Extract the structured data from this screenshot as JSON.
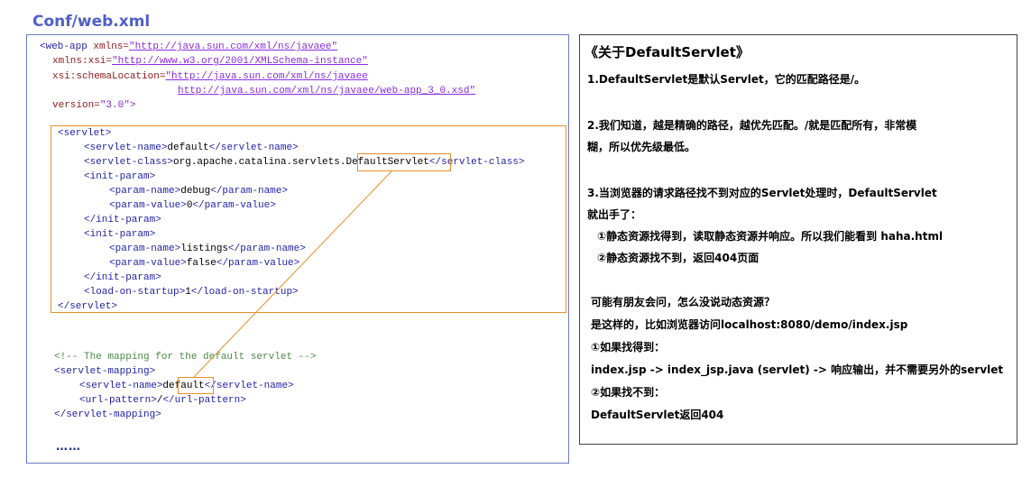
{
  "title": "Conf/web.xml",
  "code": {
    "webapp_open": "<web-app",
    "xmlns_attr": "xmlns=",
    "xmlns_val": "\"http://java.sun.com/xml/ns/javaee\"",
    "xsi_attr": "xmlns:xsi=",
    "xsi_val": "\"http://www.w3.org/2001/XMLSchema-instance\"",
    "schema_attr": "xsi:schemaLocation=",
    "schema_val1": "\"http://java.sun.com/xml/ns/javaee",
    "schema_val2": "http://java.sun.com/xml/ns/javaee/web-app_3_0.xsd\"",
    "version_attr": "version=",
    "version_val": "\"3.0\">",
    "servlet_open": "<servlet>",
    "sname_open": "<servlet-name>",
    "sname_val": "default",
    "sname_close": "</servlet-name>",
    "sclass_open": "<servlet-class>",
    "sclass_val_prefix": "org.apache.catalina.servlets.",
    "sclass_val_highlight": "DefaultServlet",
    "sclass_close": "</servlet-class>",
    "init_open": "<init-param>",
    "pname_open": "<param-name>",
    "pname_close": "</param-name>",
    "pvalue_open": "<param-value>",
    "pvalue_close": "</param-value>",
    "init_close": "</init-param>",
    "p1_name": "debug",
    "p1_value": "0",
    "p2_name": "listings",
    "p2_value": "false",
    "los_open": "<load-on-startup>",
    "los_val": "1",
    "los_close": "</load-on-startup>",
    "servlet_close": "</servlet>",
    "comment": "<!-- The mapping for the default servlet -->",
    "mapping_open": "<servlet-mapping>",
    "mname_val": "default",
    "url_open": "<url-pattern>",
    "url_val": "/",
    "url_close": "</url-pattern>",
    "mapping_close": "</servlet-mapping>",
    "ellipsis": "……"
  },
  "notes": {
    "heading": "《关于DefaultServlet》",
    "p1": "1.DefaultServlet是默认Servlet，它的匹配路径是/。",
    "p2a": "2.我们知道，越是精确的路径，越优先匹配。/就是匹配所有，非常模",
    "p2b": "糊，所以优先级最低。",
    "p3a": "3.当浏览器的请求路径找不到对应的Servlet处理时，DefaultServlet",
    "p3b": "就出手了：",
    "p3c": "①静态资源找得到，读取静态资源并响应。所以我们能看到 haha.html",
    "p3d": "②静态资源找不到，返回404页面",
    "q1": "可能有朋友会问，怎么没说动态资源？",
    "q2": "是这样的，比如浏览器访问localhost:8080/demo/index.jsp",
    "q3": "①如果找得到：",
    "q4": "index.jsp -> index_jsp.java (servlet) -> 响应输出，并不需要另外的servlet",
    "q5": "②如果找不到：",
    "q6": "DefaultServlet返回404"
  },
  "colors": {
    "title": "#4f5fc6",
    "tag": "#1f1fa8",
    "attr": "#8b1a1a",
    "url": "#8a2be2",
    "comment": "#4b8b4b",
    "highlight": "#e8902a"
  }
}
